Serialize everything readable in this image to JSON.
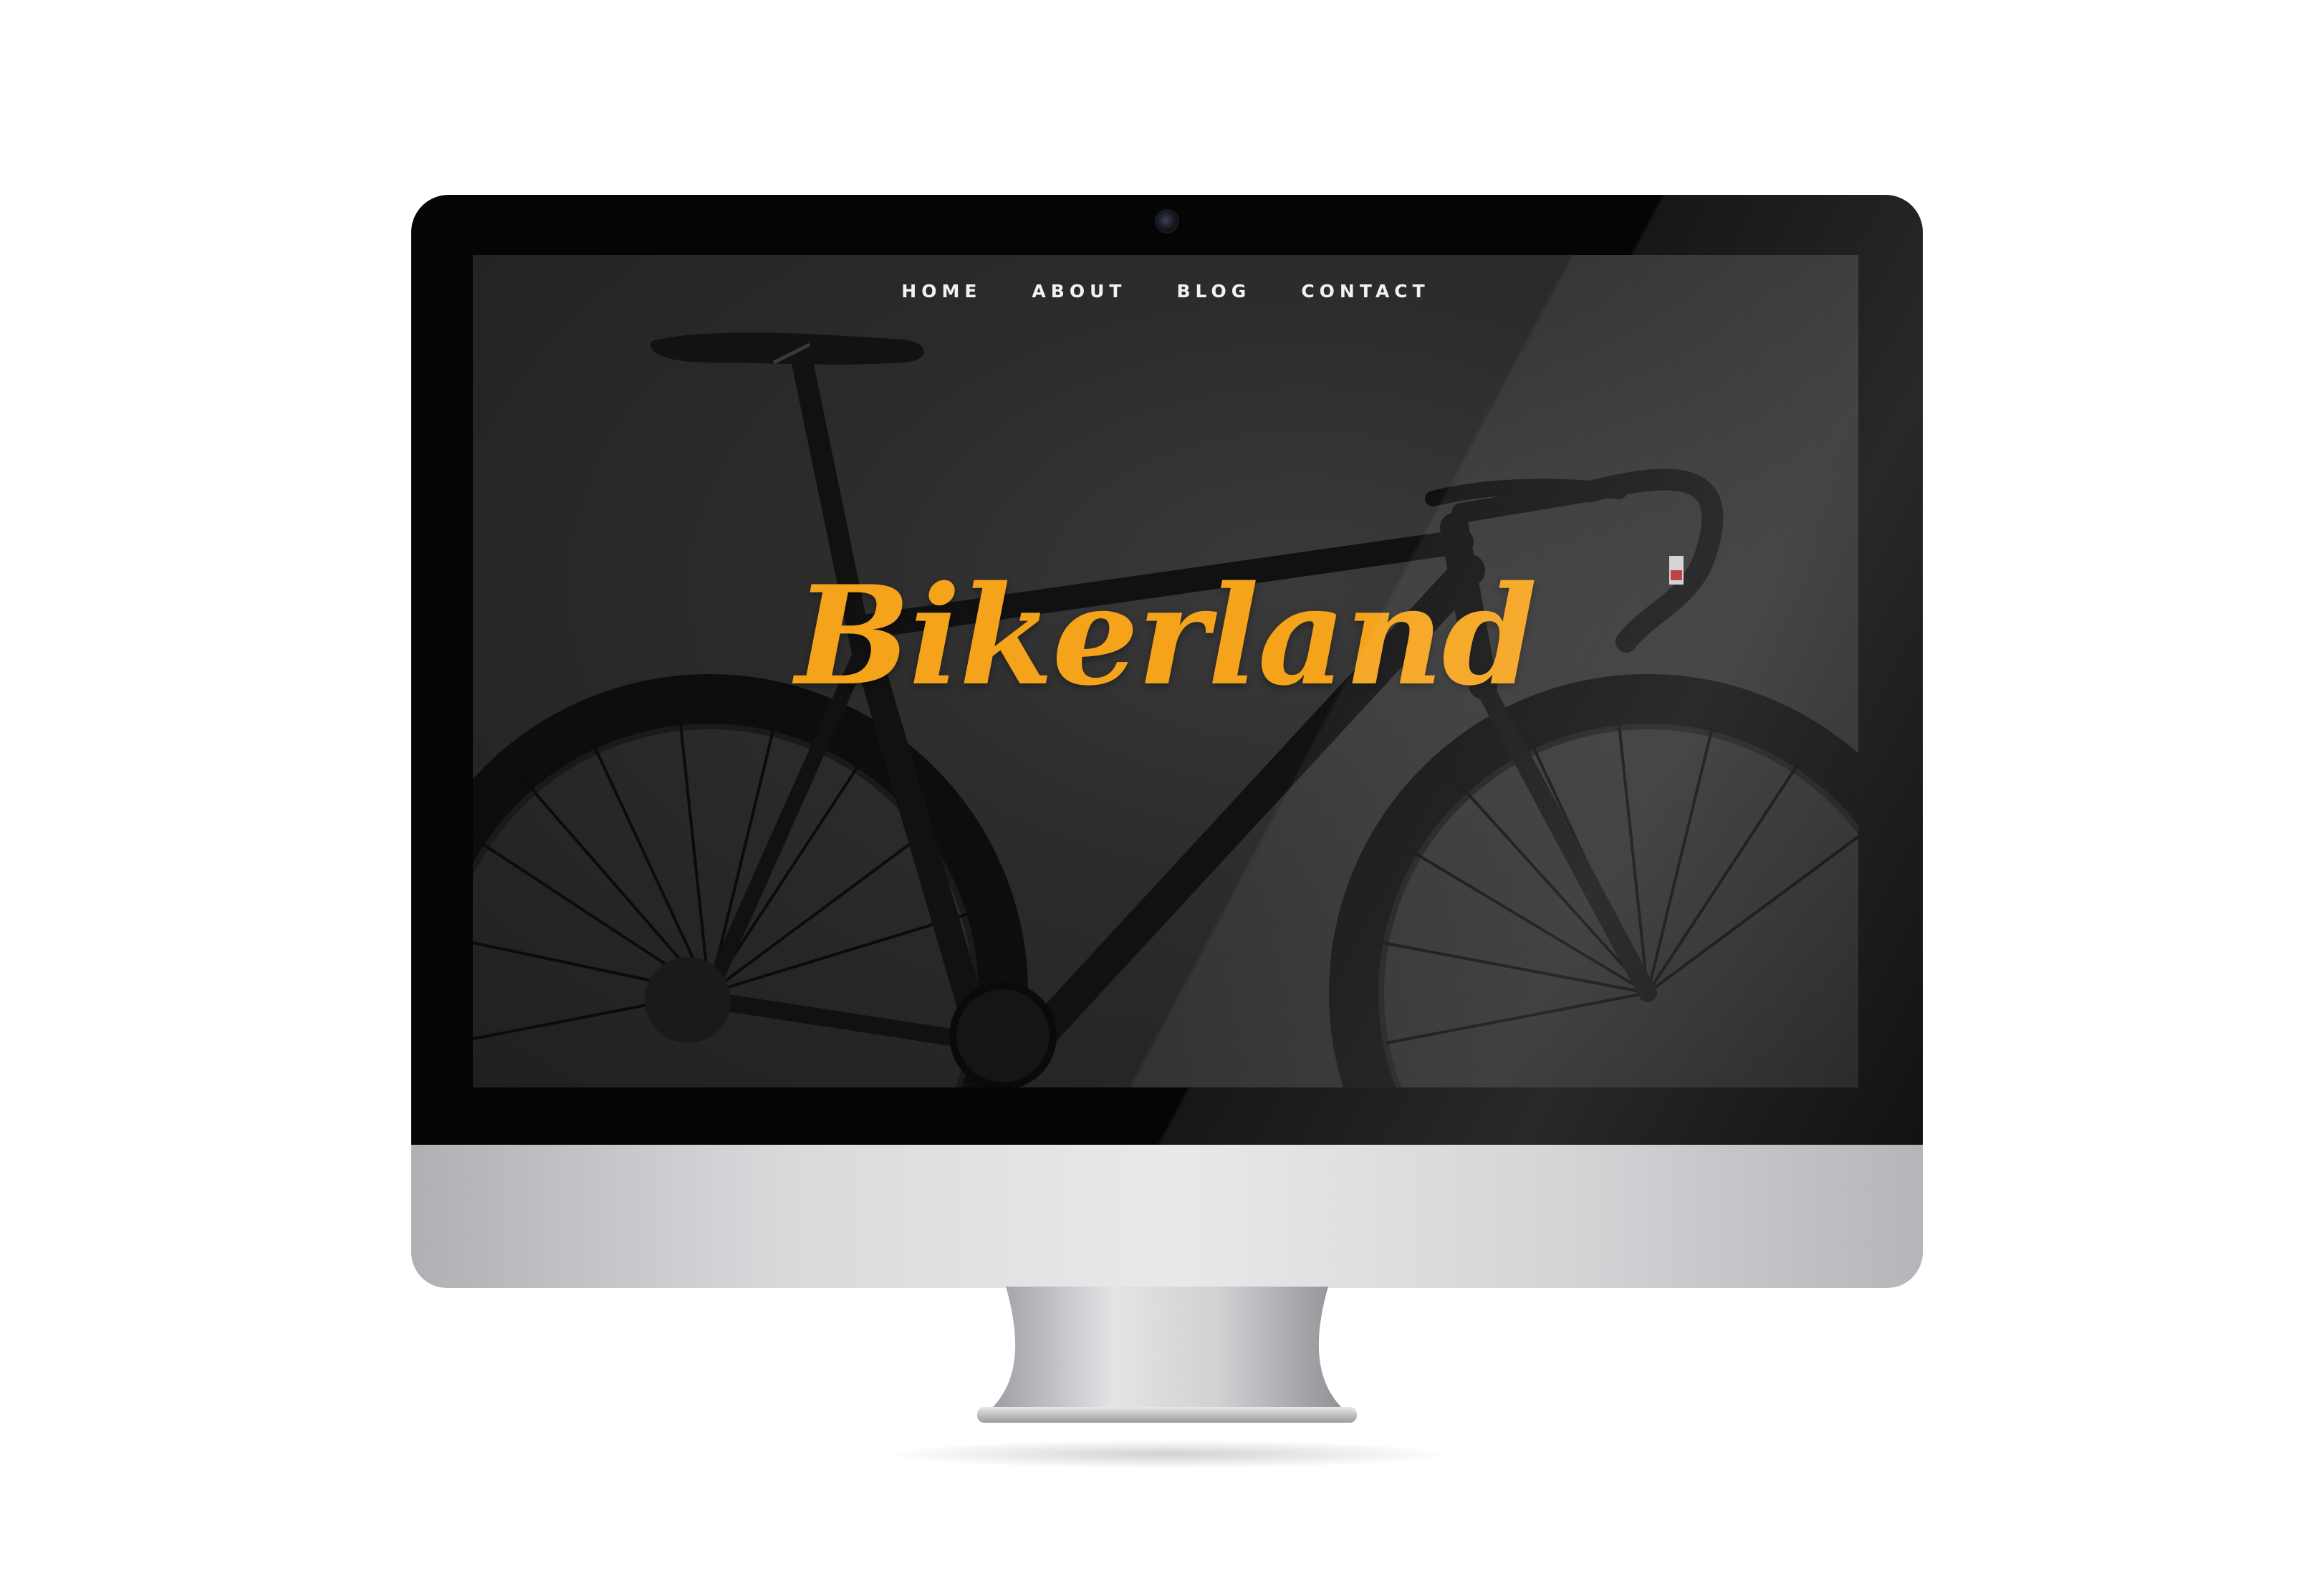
{
  "nav": {
    "items": [
      {
        "label": "HOME"
      },
      {
        "label": "ABOUT"
      },
      {
        "label": "BLOG"
      },
      {
        "label": "CONTACT"
      }
    ]
  },
  "hero": {
    "brand": "Bikerland"
  },
  "colors": {
    "brand_accent": "#f5a31b",
    "screen_background": "#2b2b2b",
    "nav_text": "#f2f2f2",
    "bezel": "#050505"
  },
  "icons": {
    "camera": "webcam-icon"
  }
}
